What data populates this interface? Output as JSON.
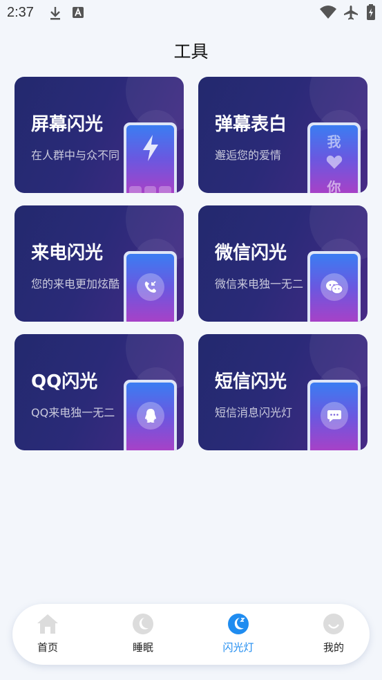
{
  "status_bar": {
    "time": "2:37"
  },
  "page": {
    "title": "工具"
  },
  "cards": [
    {
      "title": "屏幕闪光",
      "subtitle": "在人群中与众不同"
    },
    {
      "title": "弹幕表白",
      "subtitle": "邂逅您的爱情",
      "phone_text_top": "我",
      "phone_text_bottom": "你"
    },
    {
      "title": "来电闪光",
      "subtitle": "您的来电更加炫酷"
    },
    {
      "title": "微信闪光",
      "subtitle": "微信来电独一无二"
    },
    {
      "title": "QQ闪光",
      "subtitle": "QQ来电独一无二"
    },
    {
      "title": "短信闪光",
      "subtitle": "短信消息闪光灯"
    }
  ],
  "bottom_nav": {
    "items": [
      {
        "label": "首页",
        "icon": "home-icon",
        "active": false
      },
      {
        "label": "睡眠",
        "icon": "moon-icon",
        "active": false
      },
      {
        "label": "闪光灯",
        "icon": "moon-icon",
        "active": true
      },
      {
        "label": "我的",
        "icon": "profile-icon",
        "active": false
      }
    ]
  },
  "colors": {
    "background": "#f3f6fb",
    "accent": "#1f8cf0",
    "card_gradient_start": "#23296e",
    "card_gradient_end": "#472a86"
  }
}
